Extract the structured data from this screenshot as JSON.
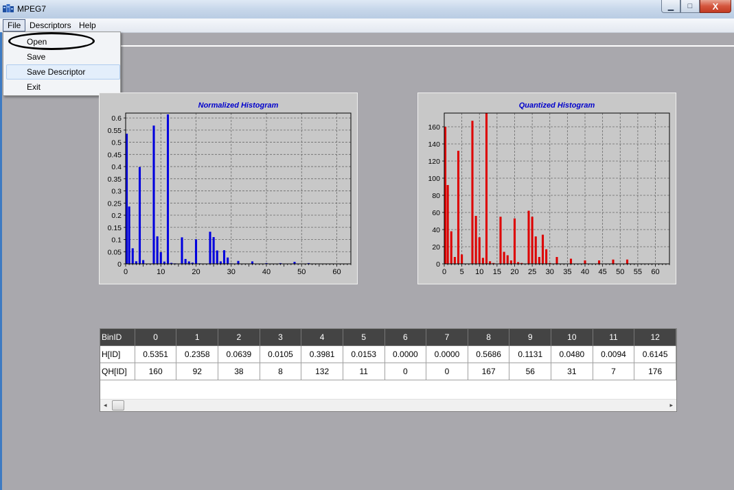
{
  "window": {
    "title": "MPEG7",
    "minimize_glyph": "▁",
    "maximize_glyph": "□",
    "close_glyph": "X"
  },
  "menu": {
    "items": [
      "File",
      "Descriptors",
      "Help"
    ],
    "open_menu": "File",
    "file_dropdown": [
      "Open",
      "Save",
      "Save Descriptor",
      "Exit"
    ],
    "highlighted": "Save Descriptor"
  },
  "chart_data": [
    {
      "type": "bar",
      "title": "Normalized Histogram",
      "color": "#0000dd",
      "xlim": [
        0,
        64
      ],
      "ylim": [
        0,
        0.62
      ],
      "xticks": [
        0,
        10,
        20,
        30,
        40,
        50,
        60
      ],
      "yticks": [
        0,
        0.05,
        0.1,
        0.15,
        0.2,
        0.25,
        0.3,
        0.35,
        0.4,
        0.45,
        0.5,
        0.55,
        0.6
      ],
      "ytick_labels": [
        "0",
        "0.05",
        "0.1",
        "0.15",
        "0.2",
        "0.25",
        "0.3",
        "0.35",
        "0.4",
        "0.45",
        "0.5",
        "0.55",
        "0.6"
      ],
      "grid": true,
      "values": [
        0.5351,
        0.2358,
        0.0639,
        0.0105,
        0.3981,
        0.0153,
        0.0,
        0.0,
        0.5686,
        0.1131,
        0.048,
        0.0094,
        0.6145,
        0.004,
        0.002,
        0.0,
        0.109,
        0.02,
        0.01,
        0.005,
        0.101,
        0.002,
        0.001,
        0.0,
        0.132,
        0.11,
        0.055,
        0.01,
        0.056,
        0.026,
        0.002,
        0.001,
        0.012,
        0.001,
        0.0,
        0.0,
        0.01,
        0.001,
        0.0,
        0.0,
        0.003,
        0.0,
        0.0,
        0.0,
        0.003,
        0.0,
        0.0,
        0.0,
        0.008,
        0.0,
        0.0,
        0.0,
        0.003,
        0.0,
        0.0,
        0.0,
        0.0,
        0.0,
        0.0,
        0.0,
        0.0,
        0.0,
        0.0,
        0.0
      ]
    },
    {
      "type": "bar",
      "title": "Quantized Histogram",
      "color": "#dd0000",
      "xlim": [
        0,
        64
      ],
      "ylim": [
        0,
        176
      ],
      "xticks": [
        0,
        5,
        10,
        15,
        20,
        25,
        30,
        35,
        40,
        45,
        50,
        55,
        60
      ],
      "yticks": [
        0,
        20,
        40,
        60,
        80,
        100,
        120,
        140,
        160
      ],
      "ytick_labels": [
        "0",
        "20",
        "40",
        "60",
        "80",
        "100",
        "120",
        "140",
        "160"
      ],
      "grid": true,
      "values": [
        160,
        92,
        38,
        8,
        132,
        11,
        0,
        0,
        167,
        56,
        31,
        7,
        176,
        3,
        1,
        0,
        55,
        14,
        10,
        4,
        53,
        2,
        1,
        0,
        62,
        55,
        32,
        8,
        34,
        17,
        1,
        0,
        8,
        0,
        0,
        0,
        6,
        0,
        0,
        0,
        4,
        0,
        0,
        0,
        4,
        0,
        0,
        0,
        5,
        0,
        0,
        0,
        5,
        0,
        0,
        0,
        0,
        0,
        0,
        0,
        0,
        0,
        0,
        0
      ]
    }
  ],
  "table": {
    "row_headers": [
      "BinID",
      "H[ID]",
      "QH[ID]"
    ],
    "bin_ids": [
      "0",
      "1",
      "2",
      "3",
      "4",
      "5",
      "6",
      "7",
      "8",
      "9",
      "10",
      "11",
      "12"
    ],
    "h_values": [
      "0.5351",
      "0.2358",
      "0.0639",
      "0.0105",
      "0.3981",
      "0.0153",
      "0.0000",
      "0.0000",
      "0.5686",
      "0.1131",
      "0.0480",
      "0.0094",
      "0.6145"
    ],
    "qh_values": [
      "160",
      "92",
      "38",
      "8",
      "132",
      "11",
      "0",
      "0",
      "167",
      "56",
      "31",
      "7",
      "176"
    ],
    "scroll_left": "◂",
    "scroll_right": "▸"
  }
}
